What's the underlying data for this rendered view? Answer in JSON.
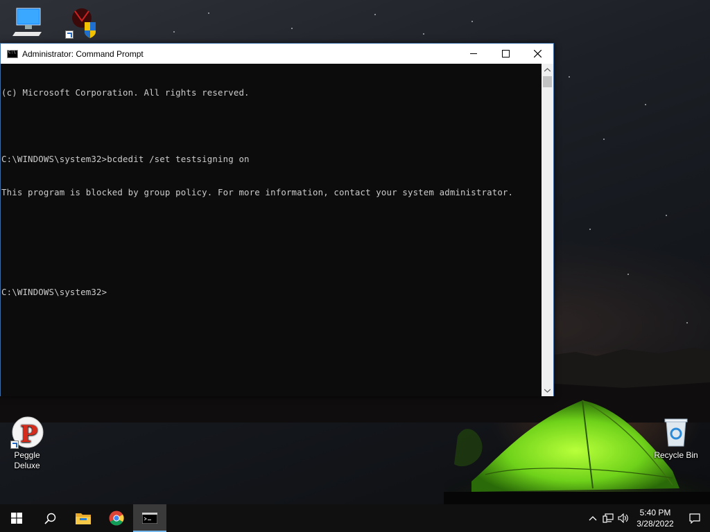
{
  "desktop": {
    "icons": [
      {
        "label": ""
      },
      {
        "label": ""
      },
      {
        "label": "Peggle\nDeluxe"
      },
      {
        "label": "Recycle Bin"
      }
    ]
  },
  "window": {
    "title": "Administrator: Command Prompt",
    "console_lines": [
      "(c) Microsoft Corporation. All rights reserved.",
      "",
      "C:\\WINDOWS\\system32>bcdedit /set testsigning on",
      "This program is blocked by group policy. For more information, contact your system administrator.",
      "",
      "",
      "C:\\WINDOWS\\system32>"
    ]
  },
  "taskbar": {
    "clock_time": "5:40 PM",
    "clock_date": "3/28/2022"
  },
  "icons": {
    "start": "windows-start-icon",
    "search": "search-icon",
    "explorer": "file-explorer-icon",
    "chrome": "chrome-icon",
    "cmd": "command-prompt-icon",
    "tray_chevron": "chevron-up-icon",
    "network": "network-icon",
    "volume": "volume-icon",
    "notifications": "notification-icon"
  },
  "colors": {
    "console_bg": "#0c0c0c",
    "console_fg": "#cccccc",
    "taskbar_bg": "#101010",
    "accent": "#76b9ed"
  }
}
